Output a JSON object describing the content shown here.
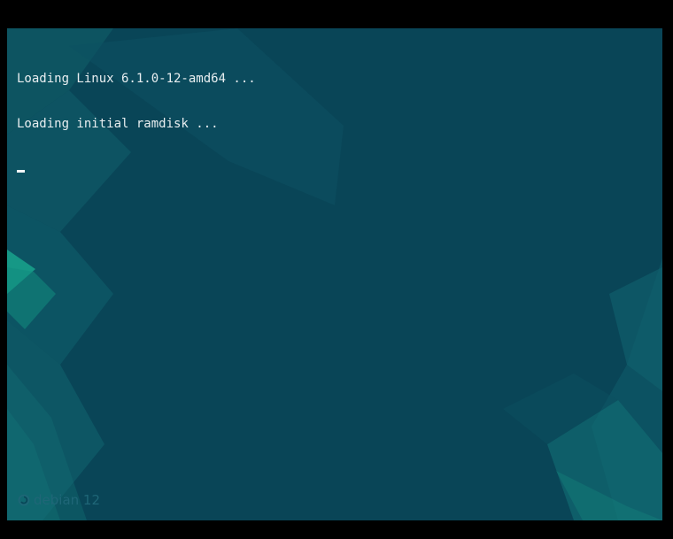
{
  "console": {
    "lines": [
      "Loading Linux 6.1.0-12-amd64 ...",
      "Loading initial ramdisk ..."
    ],
    "cursor": "_"
  },
  "branding": {
    "logo_icon": "debian-swirl-icon",
    "label": "debian 12"
  },
  "colors": {
    "background": "#094557",
    "letterbox": "#000000",
    "text": "#e8eef0",
    "accent": "#13a08a"
  }
}
